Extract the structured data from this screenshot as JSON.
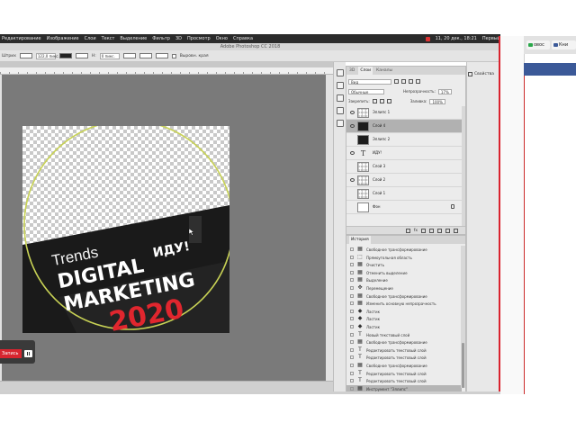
{
  "menubar": {
    "items": [
      "Редактирование",
      "Изображение",
      "Слои",
      "Текст",
      "Выделение",
      "Фильтр",
      "3D",
      "Просмотр",
      "Окно",
      "Справка"
    ],
    "status": "11, 20 дек., 18:21",
    "user": "Первый"
  },
  "window_title": "Adobe Photoshop CC 2018",
  "options_bar": {
    "label": "Штрих",
    "width_value": "122,0 пикс.",
    "h_label": "H:",
    "h_value": "0 пикс.",
    "align_label": "Выровн. края"
  },
  "canvas": {
    "text_trends": "Trends",
    "text_digital": "DIGITAL",
    "text_marketing": "MARKETING",
    "text_year": "2020",
    "text_idu": "ИДУ!",
    "colors": {
      "ring": "#c8d255",
      "year": "#e0262e",
      "band": "#1a1a1a"
    }
  },
  "recorder": {
    "label": "Запись"
  },
  "layers_panel": {
    "tabs": [
      "3D",
      "Слои",
      "Каналы"
    ],
    "active_tab": "Слои",
    "search_label": "Вид",
    "blend_mode": "Обычные",
    "opacity_label": "Непрозрачность:",
    "opacity_value": "17%",
    "lock_label": "Закрепить:",
    "fill_label": "Заливка:",
    "fill_value": "100%",
    "layers": [
      {
        "name": "Эллипс 1",
        "thumb": "checker",
        "eye": true
      },
      {
        "name": "Слой 4",
        "thumb": "dark",
        "eye": true,
        "selected": true
      },
      {
        "name": "Эллипс 2",
        "thumb": "dark",
        "eye": false
      },
      {
        "name": "ИДУ!",
        "thumb": "text",
        "eye": true
      },
      {
        "name": "Слой 3",
        "thumb": "checker",
        "eye": false
      },
      {
        "name": "Слой 2",
        "thumb": "checker",
        "eye": true
      },
      {
        "name": "Слой 1",
        "thumb": "checker",
        "eye": false
      },
      {
        "name": "Фон",
        "thumb": "white",
        "eye": false,
        "locked": true
      }
    ],
    "footer_icons": [
      "link-icon",
      "fx-icon",
      "mask-icon",
      "adjustment-icon",
      "folder-icon",
      "new-layer-icon",
      "trash-icon"
    ]
  },
  "history_panel": {
    "title": "История",
    "items": [
      {
        "label": "Свободное трансформирование",
        "icon": "▦"
      },
      {
        "label": "Прямоугольная область",
        "icon": "⬚"
      },
      {
        "label": "Очистить",
        "icon": "▦"
      },
      {
        "label": "Отменить выделение",
        "icon": "▦"
      },
      {
        "label": "Выделение",
        "icon": "▦"
      },
      {
        "label": "Перемещение",
        "icon": "✥"
      },
      {
        "label": "Свободное трансформирование",
        "icon": "▦"
      },
      {
        "label": "Изменить основную непрозрачность",
        "icon": "▦"
      },
      {
        "label": "Ластик",
        "icon": "◆"
      },
      {
        "label": "Ластик",
        "icon": "◆"
      },
      {
        "label": "Ластик",
        "icon": "◆"
      },
      {
        "label": "Новый текстовый слой",
        "icon": "T"
      },
      {
        "label": "Свободное трансформирование",
        "icon": "▦"
      },
      {
        "label": "Редактировать текстовый слой",
        "icon": "T"
      },
      {
        "label": "Редактировать текстовый слой",
        "icon": "T"
      },
      {
        "label": "Свободное трансформирование",
        "icon": "▦"
      },
      {
        "label": "Редактировать текстовый слой",
        "icon": "T"
      },
      {
        "label": "Редактировать текстовый слой",
        "icon": "T"
      },
      {
        "label": "Инструмент \"Эллипс\"",
        "icon": "▦",
        "current": true
      }
    ]
  },
  "properties_panel": {
    "label": "Свойства"
  },
  "browser": {
    "tabs": [
      {
        "label": "овос",
        "color": "#2aa84a"
      },
      {
        "label": "Кни",
        "color": "#3b5998"
      }
    ]
  }
}
